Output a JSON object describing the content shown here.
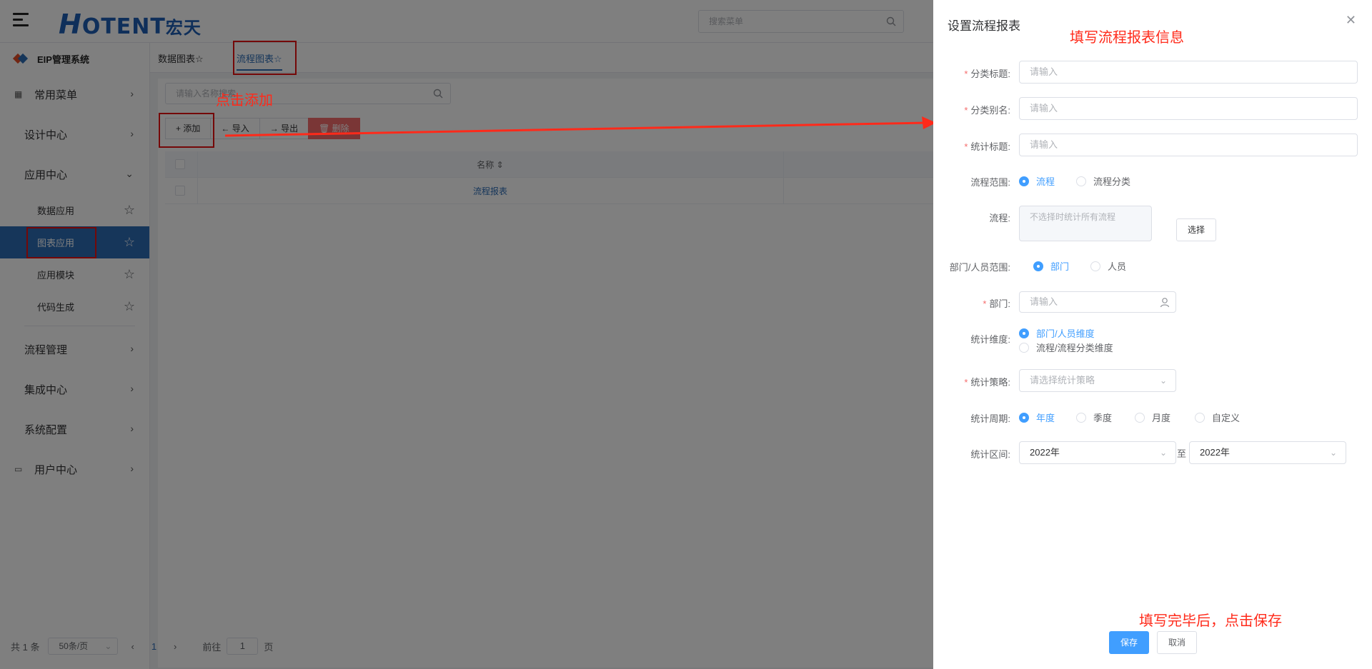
{
  "header": {
    "logo_main": "OTENT",
    "logo_initial": "H",
    "logo_cn": "宏天",
    "search_placeholder": "搜索菜单"
  },
  "sidebar": {
    "brand": "EIP管理系统",
    "items": [
      {
        "label": "常用菜单"
      },
      {
        "label": "设计中心"
      },
      {
        "label": "应用中心"
      },
      {
        "label": "流程管理"
      },
      {
        "label": "集成中心"
      },
      {
        "label": "系统配置"
      },
      {
        "label": "用户中心"
      }
    ],
    "sub_items": [
      {
        "label": "数据应用"
      },
      {
        "label": "图表应用"
      },
      {
        "label": "应用模块"
      },
      {
        "label": "代码生成"
      }
    ]
  },
  "tabs": [
    {
      "label": "数据图表"
    },
    {
      "label": "流程图表"
    }
  ],
  "list": {
    "search_placeholder": "请输入名称搜索",
    "buttons": {
      "add": "添加",
      "import": "导入",
      "export": "导出",
      "delete": "删除"
    },
    "column_name": "名称",
    "rows": [
      {
        "name": "流程报表"
      }
    ],
    "pagination": {
      "total": "共 1 条",
      "page_size": "50条/页",
      "current_page": "1",
      "goto_label": "前往",
      "goto_value": "1",
      "page_suffix": "页"
    }
  },
  "drawer": {
    "title": "设置流程报表",
    "fields": {
      "category_title": {
        "label": "分类标题:",
        "placeholder": "请输入"
      },
      "category_alias": {
        "label": "分类别名:",
        "placeholder": "请输入"
      },
      "stat_title": {
        "label": "统计标题:",
        "placeholder": "请输入"
      },
      "flow_scope": {
        "label": "流程范围:",
        "options": [
          "流程",
          "流程分类"
        ],
        "selected": "流程"
      },
      "flow": {
        "label": "流程:",
        "placeholder": "不选择时统计所有流程",
        "select_button": "选择"
      },
      "org_scope": {
        "label": "部门/人员范围:",
        "options": [
          "部门",
          "人员"
        ],
        "selected": "部门"
      },
      "dept": {
        "label": "部门:",
        "placeholder": "请输入"
      },
      "stat_dimension": {
        "label": "统计维度:",
        "options": [
          "部门/人员维度",
          "流程/流程分类维度"
        ],
        "selected": "部门/人员维度"
      },
      "stat_strategy": {
        "label": "统计策略:",
        "placeholder": "请选择统计策略"
      },
      "stat_period": {
        "label": "统计周期:",
        "options": [
          "年度",
          "季度",
          "月度",
          "自定义"
        ],
        "selected": "年度"
      },
      "stat_range": {
        "label": "统计区间:",
        "from": "2022年",
        "separator": "至",
        "to": "2022年"
      }
    },
    "save": "保存",
    "cancel": "取消"
  },
  "annotations": {
    "click_add": "点击添加",
    "fill_info": "填写流程报表信息",
    "save_hint": "填写完毕后，点击保存"
  },
  "colors": {
    "primary": "#409eff",
    "brand_blue": "#2d6cb5",
    "annotation_red": "#ff2a1a",
    "required_red": "#f56c6c"
  }
}
